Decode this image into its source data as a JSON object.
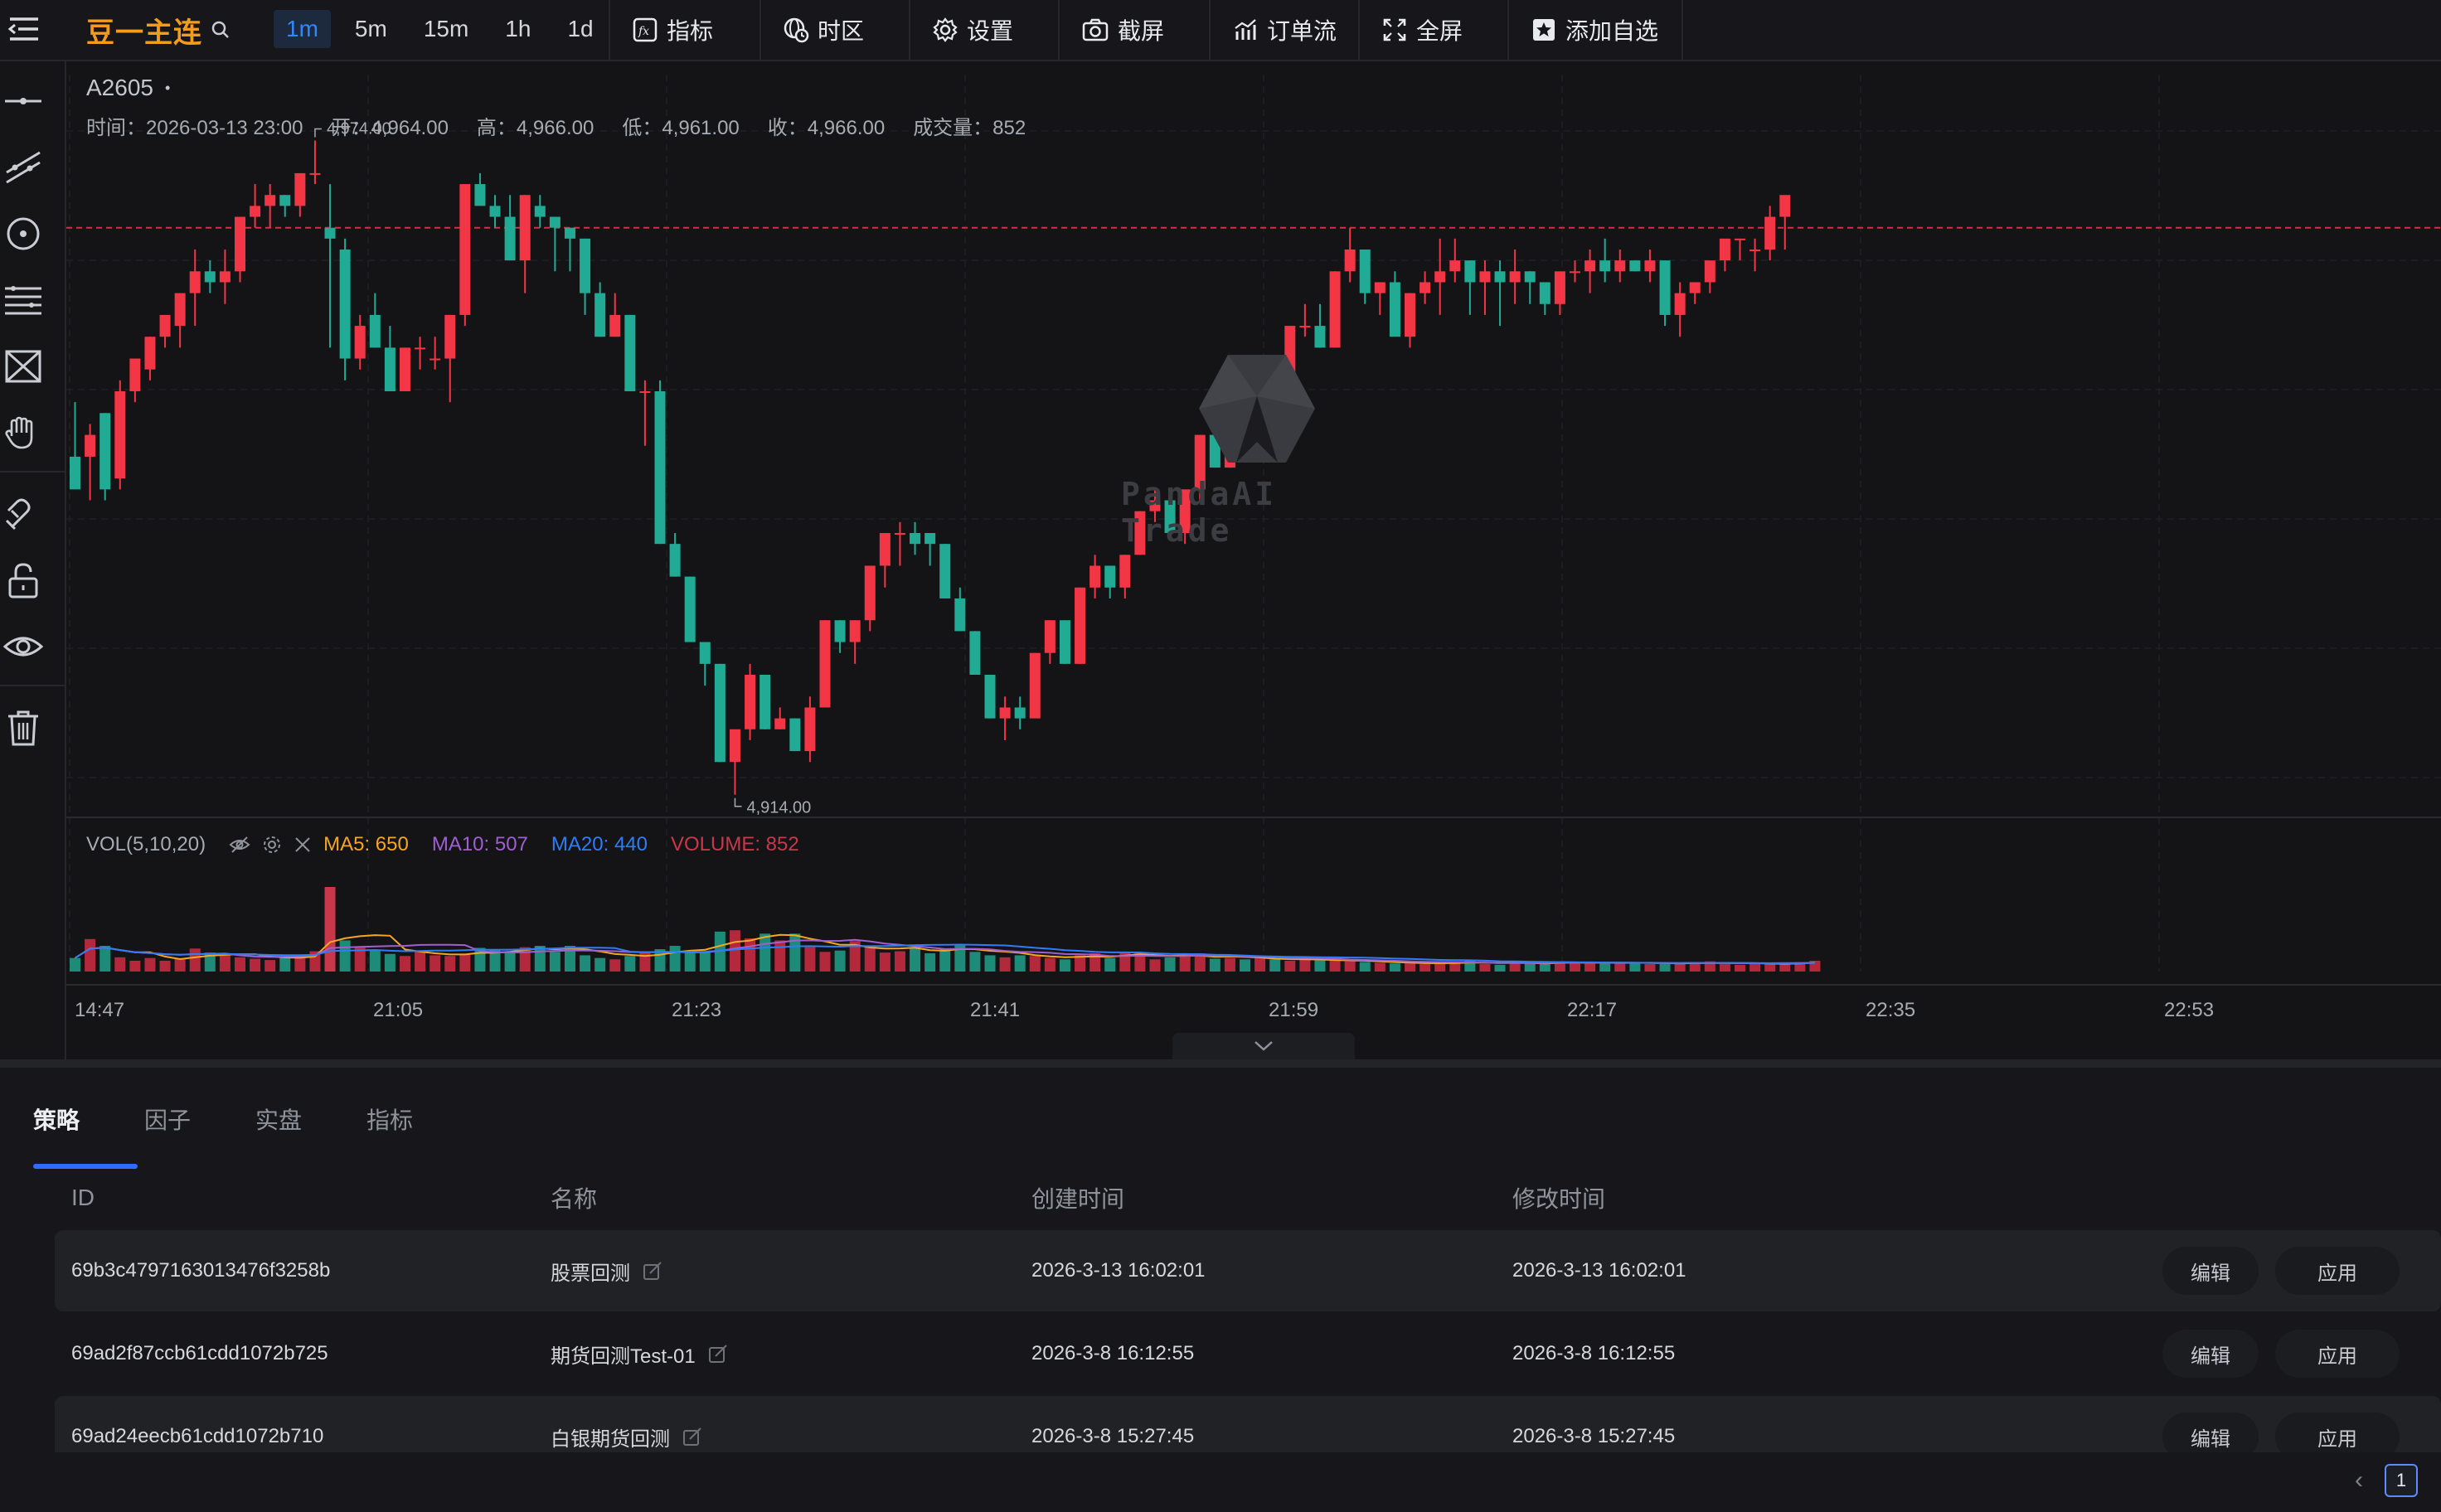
{
  "toolbar": {
    "symbol_name": "豆一主连",
    "intervals": [
      "1m",
      "5m",
      "15m",
      "1h",
      "1d"
    ],
    "active_interval": "1m",
    "buttons": {
      "indicators": "指标",
      "timezone": "时区",
      "settings": "设置",
      "screenshot": "截屏",
      "orderflow": "订单流",
      "fullscreen": "全屏",
      "watchlist": "添加自选"
    }
  },
  "chart": {
    "symbol": "A2605",
    "ohlc": {
      "time": "时间：2026-03-13 23:00",
      "open": "开：4,964.00",
      "high": "高：4,966.00",
      "low": "低：4,961.00",
      "close": "收：4,966.00",
      "volume": "成交量：852"
    },
    "high_marker": "4,974.00",
    "low_marker": "4,914.00",
    "watermark": "PandaAI Trade",
    "vol_legend": {
      "name": "VOL(5,10,20)",
      "ma5": "MA5: 650",
      "ma10": "MA10: 507",
      "ma20": "MA20: 440",
      "volume": "VOLUME: 852"
    },
    "colors": {
      "up": "#f23645",
      "down": "#22ab94",
      "ma5": "#f5a623",
      "ma10": "#a05fd0",
      "ma20": "#2f7cf6",
      "volume": "#c9374a",
      "current_price_line": "#f23645"
    }
  },
  "chart_data": {
    "type": "candlestick",
    "x_tick_labels": [
      "14:47",
      "21:05",
      "21:23",
      "21:41",
      "21:59",
      "22:17",
      "22:35",
      "22:53"
    ],
    "price_range": [
      4912,
      4977
    ],
    "current_price": 4966,
    "marked_high": 4974,
    "marked_low": 4914,
    "candles": [
      [
        4945,
        4950,
        4942,
        4942
      ],
      [
        4945,
        4948,
        4941,
        4947
      ],
      [
        4949,
        4949,
        4941,
        4942
      ],
      [
        4943,
        4952,
        4942,
        4951
      ],
      [
        4951,
        4954,
        4950,
        4954
      ],
      [
        4953,
        4956,
        4952,
        4956
      ],
      [
        4956,
        4958,
        4955,
        4958
      ],
      [
        4957,
        4960,
        4955,
        4960
      ],
      [
        4960,
        4964,
        4957,
        4962
      ],
      [
        4962,
        4963,
        4960,
        4961
      ],
      [
        4961,
        4964,
        4959,
        4962
      ],
      [
        4962,
        4967,
        4961,
        4967
      ],
      [
        4967,
        4970,
        4966,
        4968
      ],
      [
        4968,
        4970,
        4966,
        4969
      ],
      [
        4969,
        4969,
        4967,
        4968
      ],
      [
        4968,
        4971,
        4967,
        4971
      ],
      [
        4971,
        4974,
        4970,
        4971
      ],
      [
        4966,
        4970,
        4955,
        4965
      ],
      [
        4964,
        4965,
        4952,
        4954
      ],
      [
        4954,
        4958,
        4953,
        4957
      ],
      [
        4958,
        4960,
        4955,
        4955
      ],
      [
        4955,
        4957,
        4951,
        4951
      ],
      [
        4951,
        4955,
        4951,
        4955
      ],
      [
        4955,
        4956,
        4953,
        4955
      ],
      [
        4954,
        4956,
        4953,
        4954
      ],
      [
        4954,
        4958,
        4950,
        4958
      ],
      [
        4958,
        4970,
        4957,
        4970
      ],
      [
        4970,
        4971,
        4969,
        4968
      ],
      [
        4968,
        4969,
        4966,
        4967
      ],
      [
        4967,
        4969,
        4964,
        4963
      ],
      [
        4963,
        4969,
        4960,
        4969
      ],
      [
        4968,
        4969,
        4966,
        4967
      ],
      [
        4967,
        4967,
        4962,
        4966
      ],
      [
        4966,
        4966,
        4962,
        4965
      ],
      [
        4965,
        4965,
        4958,
        4960
      ],
      [
        4960,
        4961,
        4956,
        4956
      ],
      [
        4956,
        4960,
        4956,
        4958
      ],
      [
        4958,
        4958,
        4951,
        4951
      ],
      [
        4951,
        4952,
        4946,
        4951
      ],
      [
        4951,
        4952,
        4937,
        4937
      ],
      [
        4937,
        4938,
        4934,
        4934
      ],
      [
        4934,
        4934,
        4928,
        4928
      ],
      [
        4928,
        4928,
        4924,
        4926
      ],
      [
        4926,
        4926,
        4917,
        4917
      ],
      [
        4917,
        4918,
        4914,
        4920
      ],
      [
        4920,
        4926,
        4919,
        4925
      ],
      [
        4925,
        4925,
        4920,
        4920
      ],
      [
        4920,
        4922,
        4920,
        4921
      ],
      [
        4921,
        4921,
        4918,
        4918
      ],
      [
        4918,
        4923,
        4917,
        4922
      ],
      [
        4922,
        4930,
        4922,
        4930
      ],
      [
        4930,
        4930,
        4927,
        4928
      ],
      [
        4928,
        4930,
        4926,
        4930
      ],
      [
        4930,
        4935,
        4929,
        4935
      ],
      [
        4935,
        4938,
        4933,
        4938
      ],
      [
        4938,
        4939,
        4935,
        4938
      ],
      [
        4938,
        4939,
        4936,
        4937
      ],
      [
        4938,
        4938,
        4935,
        4937
      ],
      [
        4937,
        4937,
        4932,
        4932
      ],
      [
        4932,
        4933,
        4930,
        4929
      ],
      [
        4929,
        4929,
        4925,
        4925
      ],
      [
        4925,
        4925,
        4921,
        4921
      ],
      [
        4921,
        4923,
        4919,
        4922
      ],
      [
        4922,
        4923,
        4920,
        4921
      ],
      [
        4921,
        4927,
        4921,
        4927
      ],
      [
        4927,
        4930,
        4926,
        4930
      ],
      [
        4930,
        4930,
        4926,
        4926
      ],
      [
        4926,
        4933,
        4926,
        4933
      ],
      [
        4933,
        4936,
        4932,
        4935
      ],
      [
        4935,
        4935,
        4932,
        4933
      ],
      [
        4933,
        4936,
        4932,
        4936
      ],
      [
        4936,
        4940,
        4936,
        4940
      ],
      [
        4940,
        4942,
        4939,
        4941
      ],
      [
        4941,
        4942,
        4938,
        4938
      ],
      [
        4938,
        4942,
        4937,
        4942
      ],
      [
        4942,
        4947,
        4941,
        4947
      ],
      [
        4947,
        4948,
        4944,
        4944
      ],
      [
        4944,
        4949,
        4944,
        4949
      ],
      [
        4949,
        4952,
        4948,
        4948
      ],
      [
        4948,
        4950,
        4948,
        4950
      ],
      [
        4950,
        4950,
        4949,
        4949
      ],
      [
        4949,
        4957,
        4948,
        4957
      ],
      [
        4957,
        4959,
        4956,
        4957
      ],
      [
        4957,
        4959,
        4955,
        4955
      ],
      [
        4955,
        4962,
        4955,
        4962
      ],
      [
        4962,
        4966,
        4961,
        4964
      ],
      [
        4964,
        4964,
        4959,
        4960
      ],
      [
        4960,
        4961,
        4958,
        4961
      ],
      [
        4961,
        4962,
        4958,
        4956
      ],
      [
        4956,
        4960,
        4955,
        4960
      ],
      [
        4960,
        4962,
        4959,
        4961
      ],
      [
        4961,
        4965,
        4958,
        4962
      ],
      [
        4962,
        4965,
        4961,
        4963
      ],
      [
        4963,
        4963,
        4958,
        4961
      ],
      [
        4961,
        4963,
        4958,
        4962
      ],
      [
        4962,
        4963,
        4957,
        4961
      ],
      [
        4961,
        4964,
        4959,
        4962
      ],
      [
        4962,
        4962,
        4959,
        4961
      ],
      [
        4961,
        4961,
        4958,
        4959
      ],
      [
        4959,
        4960,
        4958,
        4962
      ],
      [
        4962,
        4963,
        4961,
        4962
      ],
      [
        4962,
        4964,
        4960,
        4963
      ],
      [
        4963,
        4965,
        4961,
        4962
      ],
      [
        4962,
        4964,
        4961,
        4963
      ],
      [
        4963,
        4963,
        4962,
        4962
      ],
      [
        4962,
        4964,
        4961,
        4963
      ],
      [
        4963,
        4963,
        4957,
        4958
      ],
      [
        4958,
        4961,
        4956,
        4960
      ],
      [
        4960,
        4961,
        4959,
        4961
      ],
      [
        4961,
        4962,
        4960,
        4963
      ],
      [
        4963,
        4964,
        4962,
        4965
      ],
      [
        4965,
        4965,
        4963,
        4965
      ],
      [
        4964,
        4965,
        4962,
        4964
      ],
      [
        4964,
        4968,
        4963,
        4967
      ],
      [
        4967,
        4968,
        4964,
        4969
      ]
    ],
    "volume_range": [
      0,
      1250
    ],
    "volumes": [
      200,
      480,
      380,
      210,
      160,
      200,
      160,
      190,
      340,
      280,
      260,
      210,
      190,
      170,
      210,
      240,
      300,
      1250,
      460,
      360,
      320,
      260,
      230,
      300,
      240,
      230,
      260,
      350,
      320,
      300,
      360,
      380,
      290,
      380,
      240,
      200,
      180,
      230,
      300,
      330,
      380,
      300,
      300,
      590,
      610,
      490,
      560,
      460,
      560,
      360,
      290,
      310,
      450,
      370,
      280,
      300,
      360,
      270,
      330,
      400,
      290,
      240,
      210,
      240,
      230,
      200,
      180,
      240,
      270,
      200,
      290,
      280,
      180,
      210,
      240,
      270,
      190,
      200,
      180,
      200,
      180,
      160,
      180,
      170,
      160,
      150,
      140,
      130,
      120,
      120,
      110,
      130,
      140,
      160,
      110,
      100,
      140,
      130,
      120,
      150,
      120,
      130,
      140,
      120,
      140,
      110,
      110,
      120,
      140,
      150,
      110,
      100,
      120,
      110,
      130,
      140,
      160
    ]
  },
  "bottom": {
    "tabs": [
      "策略",
      "因子",
      "实盘",
      "指标"
    ],
    "active_tab": 0,
    "columns": [
      "ID",
      "名称",
      "创建时间",
      "修改时间"
    ],
    "rows": [
      {
        "id": "69b3c4797163013476f3258b",
        "name": "股票回测",
        "created": "2026-3-13 16:02:01",
        "modified": "2026-3-13 16:02:01",
        "edit": "编辑",
        "apply": "应用"
      },
      {
        "id": "69ad2f87ccb61cdd1072b725",
        "name": "期货回测Test-01",
        "created": "2026-3-8 16:12:55",
        "modified": "2026-3-8 16:12:55",
        "edit": "编辑",
        "apply": "应用"
      },
      {
        "id": "69ad24eecb61cdd1072b710",
        "name": "白银期货回测",
        "created": "2026-3-8 15:27:45",
        "modified": "2026-3-8 15:27:45",
        "edit": "编辑",
        "apply": "应用"
      }
    ],
    "pagination": {
      "current": "1",
      "prev_icon": "‹"
    }
  }
}
